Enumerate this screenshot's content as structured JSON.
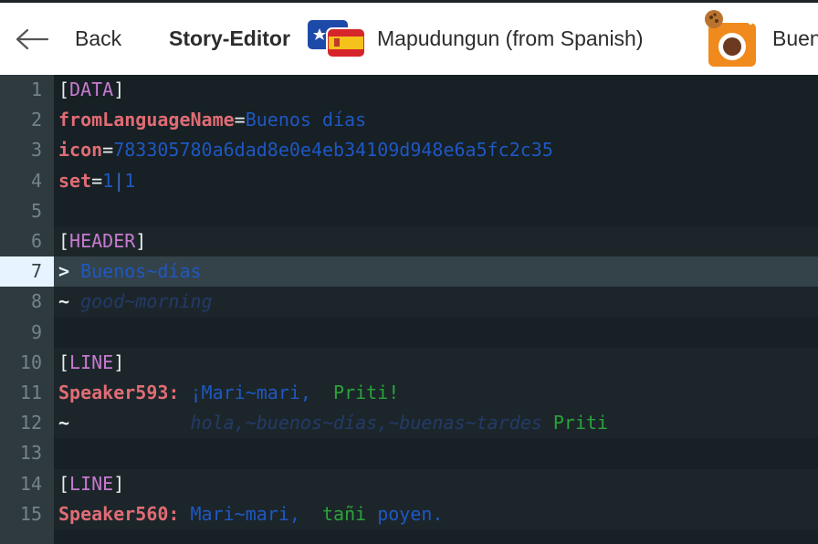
{
  "header": {
    "back_label": "Back",
    "editor_title": "Story-Editor",
    "course_name": "Mapudungun (from Spanish)",
    "story_title": "Buen"
  },
  "editor": {
    "lines": [
      {
        "n": "1",
        "parts": [
          [
            "br",
            "["
          ],
          [
            "sec",
            "DATA"
          ],
          [
            "br",
            "]"
          ]
        ]
      },
      {
        "n": "2",
        "parts": [
          [
            "key",
            "fromLanguageName"
          ],
          [
            "eq",
            "="
          ],
          [
            "val",
            "Buenos días"
          ]
        ]
      },
      {
        "n": "3",
        "parts": [
          [
            "key",
            "icon"
          ],
          [
            "eq",
            "="
          ],
          [
            "val",
            "783305780a6dad8e0e4eb34109d948e6a5fc2c35"
          ]
        ]
      },
      {
        "n": "4",
        "parts": [
          [
            "key",
            "set"
          ],
          [
            "eq",
            "="
          ],
          [
            "val",
            "1"
          ],
          [
            "pipe",
            "|"
          ],
          [
            "val",
            "1"
          ]
        ]
      },
      {
        "n": "5",
        "parts": []
      },
      {
        "n": "6",
        "parts": [
          [
            "br",
            "["
          ],
          [
            "sec",
            "HEADER"
          ],
          [
            "br",
            "]"
          ]
        ]
      },
      {
        "n": "7",
        "parts": [
          [
            "hl",
            "> "
          ],
          [
            "txt",
            "Buenos~días"
          ]
        ]
      },
      {
        "n": "8",
        "parts": [
          [
            "hl",
            "~ "
          ],
          [
            "ital",
            "good~morning"
          ]
        ]
      },
      {
        "n": "9",
        "parts": []
      },
      {
        "n": "10",
        "parts": [
          [
            "br",
            "["
          ],
          [
            "sec",
            "LINE"
          ],
          [
            "br",
            "]"
          ]
        ]
      },
      {
        "n": "11",
        "parts": [
          [
            "spk",
            "Speaker593:"
          ],
          [
            "txt",
            " ¡Mari~mari, "
          ],
          [
            "green",
            " Priti!"
          ]
        ]
      },
      {
        "n": "12",
        "parts": [
          [
            "hl",
            "~"
          ],
          [
            "ital",
            "           hola,~buenos~días,~buenas~tardes "
          ],
          [
            "green",
            "Priti"
          ]
        ]
      },
      {
        "n": "13",
        "parts": []
      },
      {
        "n": "14",
        "parts": [
          [
            "br",
            "["
          ],
          [
            "sec",
            "LINE"
          ],
          [
            "br",
            "]"
          ]
        ]
      },
      {
        "n": "15",
        "parts": [
          [
            "spk",
            "Speaker560:"
          ],
          [
            "txt",
            " Mari~mari, "
          ],
          [
            "green",
            " tañi"
          ],
          [
            "txt",
            " poyen."
          ]
        ]
      }
    ]
  }
}
